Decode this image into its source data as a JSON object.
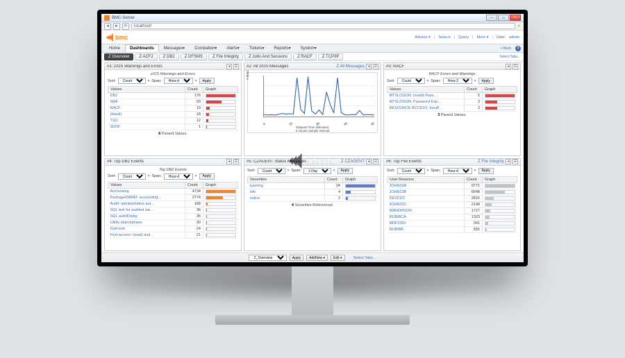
{
  "window": {
    "title": "BMC-Server",
    "address": "localhost/"
  },
  "brand": "bmc",
  "header_links": [
    "Advisor ▾",
    "Search",
    "Query",
    "More ▾"
  ],
  "header_user_label": "User:",
  "header_user": "admin",
  "back_label": "< Back",
  "main_tabs": [
    "Home",
    "Dashboards",
    "Messages▾",
    "Correlation▾",
    "Alerts▾",
    "Tickets▾",
    "Reports▾",
    "System▾"
  ],
  "main_active": 1,
  "sub_tabs": [
    "Z Overview",
    "Z ACF2",
    "Z DB2",
    "Z DFSMS",
    "Z File Integrity",
    "Z Jobs And Sessions",
    "Z RACF",
    "Z TCP/IP"
  ],
  "sub_active": 0,
  "select_tabs_label": "Select Tabs…",
  "sort_label": "Sort:",
  "sort_options": [
    "Count"
  ],
  "span_label": "Span:",
  "apply_label": "Apply",
  "cols": {
    "values": "Values",
    "count": "Count",
    "graph": "Graph",
    "severities": "Severities",
    "user_reasons": "User Reasons"
  },
  "panels": {
    "p1": {
      "title": "#1: z/OS Warnings and Errors",
      "subtitle": "z/OS Warnings and Errors",
      "span": "Hour-d",
      "rows": [
        {
          "label": "DB2",
          "count": 176,
          "pct": 100,
          "cls": "c-red"
        },
        {
          "label": "SMF",
          "count": 93,
          "pct": 53,
          "cls": "c-red"
        },
        {
          "label": "RACF",
          "count": 19,
          "pct": 11,
          "cls": "c-red"
        },
        {
          "label": "(blank)",
          "count": 18,
          "pct": 10,
          "cls": "c-red"
        },
        {
          "label": "TSO",
          "count": 12,
          "pct": 7,
          "cls": "c-red"
        },
        {
          "label": "SDSF",
          "count": 1,
          "pct": 1,
          "cls": "c-red"
        }
      ],
      "footer_n": "6",
      "footer_t": "Parsed Values."
    },
    "p2": {
      "title": "#2: All z/OS Messages",
      "link": "Z All Messages"
    },
    "p3": {
      "title": "#3: RACF",
      "subtitle": "RACF Errors and Warnings",
      "span": "Hour-2",
      "rows": [
        {
          "label": "MTSLOGON: Invalid Pass…",
          "count": 5,
          "pct": 100,
          "cls": "c-red"
        },
        {
          "label": "MTSLOGON: Password Exp…",
          "count": 2,
          "pct": 40,
          "cls": "c-red"
        },
        {
          "label": "RESOURCE ACCESS: Insuff…",
          "count": 2,
          "pct": 40,
          "cls": "c-red"
        }
      ],
      "footer_n": "3",
      "footer_t": "Parsed Values."
    },
    "p4": {
      "title": "#4: Top DB2 Events",
      "subtitle": "Top DB2 Events",
      "span": "Hour-d",
      "rows": [
        {
          "label": "Accounting",
          "count": 4734,
          "pct": 100,
          "cls": "c-orange"
        },
        {
          "label": "Package/DBRM: accounting…",
          "count": 2774,
          "pct": 59,
          "cls": "c-orange"
        },
        {
          "label": "Audit: administrative aut…",
          "count": 168,
          "pct": 4,
          "cls": "c-orange"
        },
        {
          "label": "SQL text for audited sta…",
          "count": 36,
          "pct": 1,
          "cls": "c-orange"
        },
        {
          "label": "SQL authID/pkg",
          "count": 36,
          "pct": 1,
          "cls": "c-orange"
        },
        {
          "label": "Utility object/phase",
          "count": 30,
          "pct": 1,
          "cls": "c-orange"
        },
        {
          "label": "Grid end",
          "count": 24,
          "pct": 1,
          "cls": "c-orange"
        },
        {
          "label": "First access: (read) aud…",
          "count": 21,
          "pct": 1,
          "cls": "c-orange"
        }
      ]
    },
    "p5": {
      "title": "#5: CZAGENT Status Messages",
      "link": "Z CZAGENT",
      "span": "1-Day",
      "rows": [
        {
          "label": "warning",
          "count": 24,
          "pct": 100,
          "cls": "c-blue"
        },
        {
          "label": "info",
          "count": 4,
          "pct": 17,
          "cls": "c-blue"
        },
        {
          "label": "notice",
          "count": 2,
          "pct": 8,
          "cls": "c-blue"
        }
      ],
      "footer_n": "4",
      "footer_t": "Severities Referenced."
    },
    "p6": {
      "title": "#6: Top File Events",
      "link": "Z File Integrity",
      "span": "Hour-d",
      "rows": [
        {
          "label": "JOHN23A",
          "count": 9771,
          "pct": 100,
          "cls": "c-grey"
        },
        {
          "label": "JOHN23B",
          "count": 6648,
          "pct": 68,
          "cls": "c-grey"
        },
        {
          "label": "DEVCDC",
          "count": 2816,
          "pct": 29,
          "cls": "c-grey"
        },
        {
          "label": "JOHN23C",
          "count": 2148,
          "pct": 22,
          "cls": "c-grey"
        },
        {
          "label": "WANDRSON",
          "count": 1727,
          "pct": 18,
          "cls": "c-grey"
        },
        {
          "label": "RUBIBCA",
          "count": 1323,
          "pct": 14,
          "cls": "c-grey"
        },
        {
          "label": "MDF2000",
          "count": 941,
          "pct": 10,
          "cls": "c-grey"
        },
        {
          "label": "RUBIBB",
          "count": 555,
          "pct": 6,
          "cls": "c-grey"
        }
      ]
    }
  },
  "chart_data": {
    "type": "line",
    "title": "",
    "ylabel": "# Matched Events this interval",
    "xlabel": "Elapsed Time (Minutes)\\n2 minute sample interval",
    "ylim": [
      0,
      8000
    ],
    "x": [
      0,
      2,
      4,
      6,
      8,
      10,
      12,
      14,
      16,
      18,
      20,
      22,
      24,
      26,
      28,
      30,
      32,
      34,
      36,
      38,
      40,
      42,
      44,
      46,
      48,
      50,
      52,
      54,
      56,
      58,
      60
    ],
    "values": [
      400,
      300,
      350,
      300,
      450,
      600,
      500,
      550,
      500,
      7600,
      1400,
      600,
      7800,
      1100,
      500,
      1300,
      400,
      4800,
      2400,
      700,
      7600,
      800,
      350,
      300,
      400,
      350,
      1200,
      300,
      400,
      350,
      300
    ],
    "x_ticks": [
      "0",
      "15",
      "30",
      "45",
      "60"
    ],
    "x_tick_labels_bottom": [
      "ago",
      "ago",
      "ago",
      "ago",
      "ago"
    ]
  },
  "footer": {
    "tab": "Z_Overview",
    "apply": "Apply",
    "addnew": "AddNew ▾",
    "edit": "Edit ▾",
    "select_tabs": "Select Tabs…"
  }
}
